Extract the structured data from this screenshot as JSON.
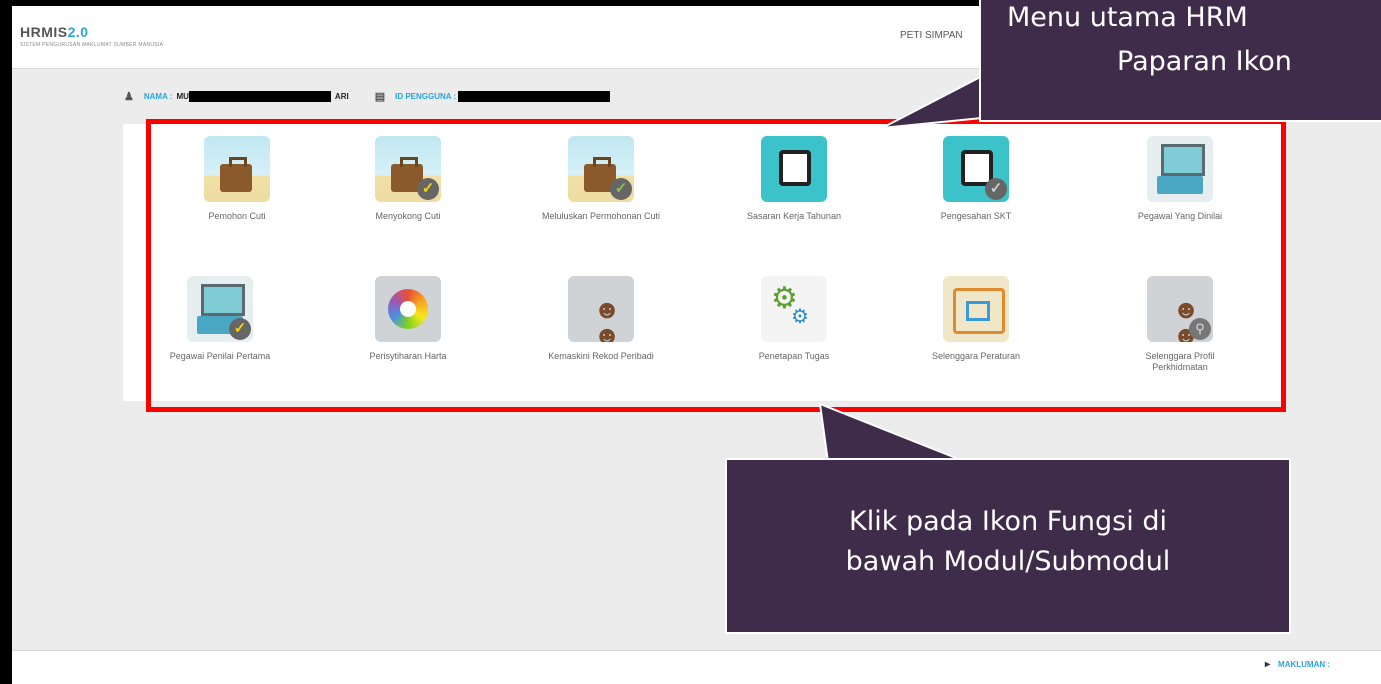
{
  "app": {
    "logo": "HRMIS",
    "logo_version": "2.0",
    "subtitle": "SISTEM PENGURUSAN MAKLUMAT SUMBER MANUSIA"
  },
  "topnav": {
    "peti_simpan": "PETI SIMPAN"
  },
  "user": {
    "nama_label": "NAMA :",
    "nama_value_start": "MU",
    "nama_value_end": "ARI",
    "id_label": "ID PENGGUNA :"
  },
  "tiles": [
    {
      "label": "Pemohon Cuti",
      "icon": "suitcase-icon"
    },
    {
      "label": "Menyokong Cuti",
      "icon": "suitcase-check-icon"
    },
    {
      "label": "Meluluskan Permohonan Cuti",
      "icon": "suitcase-approve-icon"
    },
    {
      "label": "Sasaran Kerja Tahunan",
      "icon": "tablet-chart-icon"
    },
    {
      "label": "Pengesahan SKT",
      "icon": "tablet-check-icon"
    },
    {
      "label": "Pegawai Yang Dinilai",
      "icon": "computer-icon"
    },
    {
      "label": "Pegawai Penilai Pertama",
      "icon": "computer-check-icon"
    },
    {
      "label": "Perisytiharan Harta",
      "icon": "color-wheel-icon"
    },
    {
      "label": "Kemaskini Rekod Peribadi",
      "icon": "people-icon"
    },
    {
      "label": "Penetapan Tugas",
      "icon": "gears-icon"
    },
    {
      "label": "Selenggara Peraturan",
      "icon": "flowchart-icon"
    },
    {
      "label": "Selenggara Profil Perkhidmatan",
      "icon": "people-search-icon"
    }
  ],
  "callouts": {
    "top_line1": "Menu utama HRM",
    "top_line2": "Paparan Ikon",
    "bottom_line1": "Klik pada Ikon Fungsi di",
    "bottom_line2": "bawah Modul/Submodul"
  },
  "footer": {
    "makluman": "MAKLUMAN :"
  },
  "colors": {
    "accent": "#2aa5d8",
    "highlight": "#ff0000",
    "callout_bg": "#3f2c4b"
  }
}
